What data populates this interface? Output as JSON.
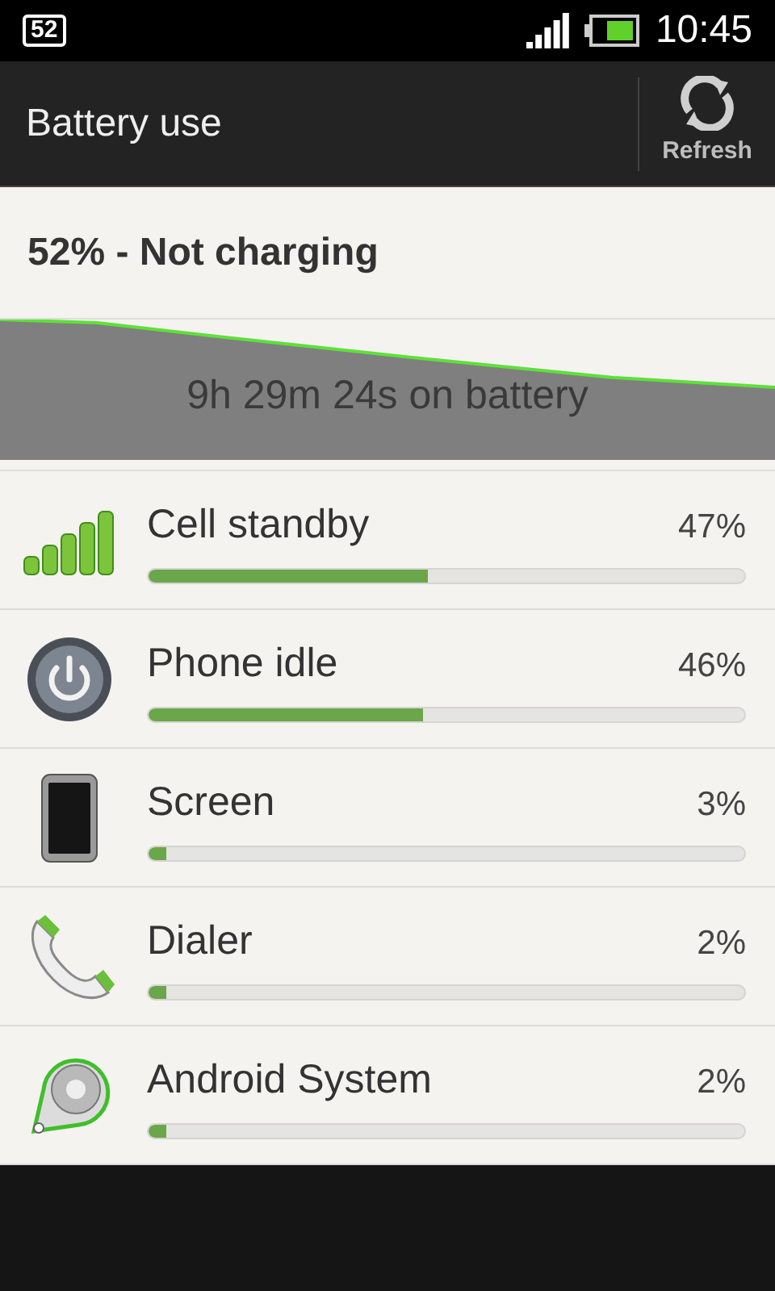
{
  "status_bar": {
    "notification": "52",
    "time": "10:45"
  },
  "header": {
    "title": "Battery use",
    "action": "Refresh"
  },
  "summary": {
    "status": "52% - Not charging",
    "graph_caption": "9h 29m 24s on battery"
  },
  "items": [
    {
      "kind": "signal",
      "name": "Cell standby",
      "percent": "47%",
      "level": 0.47
    },
    {
      "kind": "power",
      "name": "Phone idle",
      "percent": "46%",
      "level": 0.46
    },
    {
      "kind": "screen",
      "name": "Screen",
      "percent": "3%",
      "level": 0.03
    },
    {
      "kind": "dialer",
      "name": "Dialer",
      "percent": "2%",
      "level": 0.02
    },
    {
      "kind": "system",
      "name": "Android System",
      "percent": "2%",
      "level": 0.02
    }
  ]
}
